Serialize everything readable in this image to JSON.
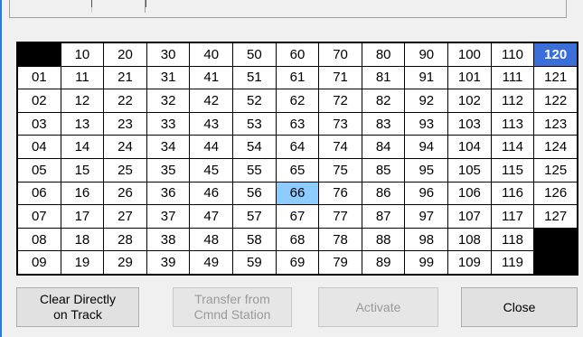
{
  "colors": {
    "selected_header": "#3a6ed8",
    "highlight_cell": "#8ecbff",
    "blank_cell": "#000000",
    "window_border": "#2b7bd8"
  },
  "grid": {
    "rows": [
      [
        "",
        "10",
        "20",
        "30",
        "40",
        "50",
        "60",
        "70",
        "80",
        "90",
        "100",
        "110",
        "120"
      ],
      [
        "01",
        "11",
        "21",
        "31",
        "41",
        "51",
        "61",
        "71",
        "81",
        "91",
        "101",
        "111",
        "121"
      ],
      [
        "02",
        "12",
        "22",
        "32",
        "42",
        "52",
        "62",
        "72",
        "82",
        "92",
        "102",
        "112",
        "122"
      ],
      [
        "03",
        "13",
        "23",
        "33",
        "43",
        "53",
        "63",
        "73",
        "83",
        "93",
        "103",
        "113",
        "123"
      ],
      [
        "04",
        "14",
        "24",
        "34",
        "44",
        "54",
        "64",
        "74",
        "84",
        "94",
        "104",
        "114",
        "124"
      ],
      [
        "05",
        "15",
        "25",
        "35",
        "45",
        "55",
        "65",
        "75",
        "85",
        "95",
        "105",
        "115",
        "125"
      ],
      [
        "06",
        "16",
        "26",
        "36",
        "46",
        "56",
        "66",
        "76",
        "86",
        "96",
        "106",
        "116",
        "126"
      ],
      [
        "07",
        "17",
        "27",
        "37",
        "47",
        "57",
        "67",
        "77",
        "87",
        "97",
        "107",
        "117",
        "127"
      ],
      [
        "08",
        "18",
        "28",
        "38",
        "48",
        "58",
        "68",
        "78",
        "88",
        "98",
        "108",
        "118",
        ""
      ],
      [
        "09",
        "19",
        "29",
        "39",
        "49",
        "59",
        "69",
        "79",
        "89",
        "99",
        "109",
        "119",
        ""
      ]
    ],
    "selected_header": "120",
    "highlighted_cell": "66"
  },
  "buttons": {
    "clear_label": "Clear Directly\non Track",
    "transfer_label": "Transfer from\nCmnd Station",
    "activate_label": "Activate",
    "close_label": "Close"
  }
}
